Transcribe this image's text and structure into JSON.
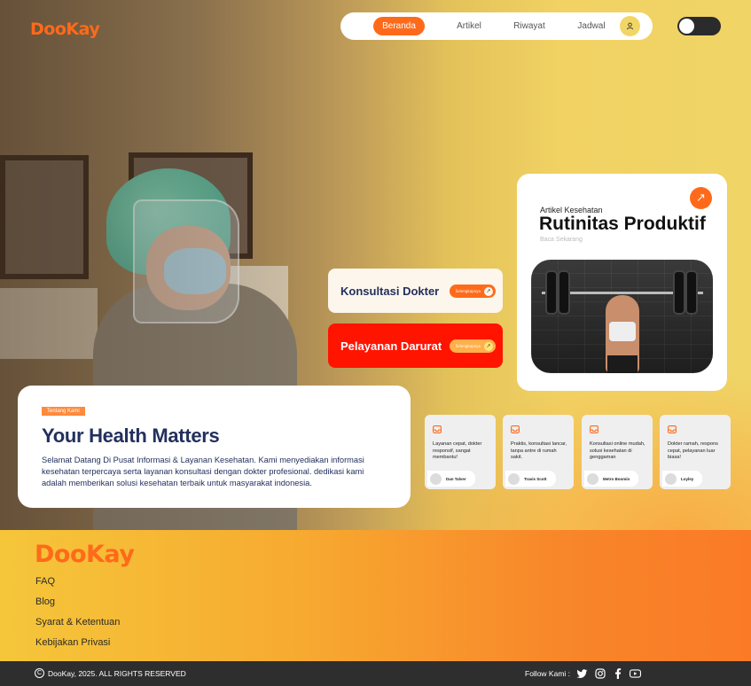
{
  "brand": {
    "logo": "DooKay",
    "accent": "#ff6a1a"
  },
  "nav": {
    "items": [
      {
        "label": "Beranda",
        "active": true
      },
      {
        "label": "Artikel"
      },
      {
        "label": "Riwayat"
      },
      {
        "label": "Jadwal"
      }
    ],
    "profile_icon": "user-icon",
    "theme_toggle": "off"
  },
  "article": {
    "category": "Artikel Kesehatan",
    "title": "Rutinitas Produktif",
    "subtitle": "Baca Sekarang",
    "arrow_icon": "arrow-up-right-icon"
  },
  "services": [
    {
      "label": "Konsultasi Dokter",
      "more": "Selengkapnya",
      "color": "#fdf6ec"
    },
    {
      "label": "Pelayanan Darurat",
      "more": "Selengkapnya",
      "color": "#ff1400"
    }
  ],
  "about": {
    "tag": "Tentang Kami",
    "title": "Your Health Matters",
    "body": "Selamat Datang Di Pusat Informasi & Layanan Kesehatan. Kami menyediakan informasi kesehatan terpercaya serta layanan konsultasi dengan dokter profesional. dedikasi kami adalah memberikan solusi kesehatan terbaik untuk masyarakat indonesia."
  },
  "testimonials": [
    {
      "text": "Layanan cepat, dokter responsif, sangat membantu!",
      "name": "Dan Talver"
    },
    {
      "text": "Praktis, konsultasi lancar, tanpa antre di rumah sakit.",
      "name": "Travis Scott"
    },
    {
      "text": "Konsultasi online mudah, solusi kesehatan di genggaman",
      "name": "Metro Boomin"
    },
    {
      "text": "Dokter ramah, respons cepat, pelayanan luar biasa!",
      "name": "Loyley"
    }
  ],
  "footer": {
    "logo": "DooKay",
    "links": [
      "FAQ",
      "Blog",
      "Syarat & Ketentuan",
      "Kebijakan Privasi"
    ],
    "copyright": "DooKay, 2025. ALL RIGHTS RESERVED",
    "follow": "Follow Kami :",
    "socials": [
      "twitter-icon",
      "instagram-icon",
      "facebook-icon",
      "youtube-icon"
    ]
  }
}
